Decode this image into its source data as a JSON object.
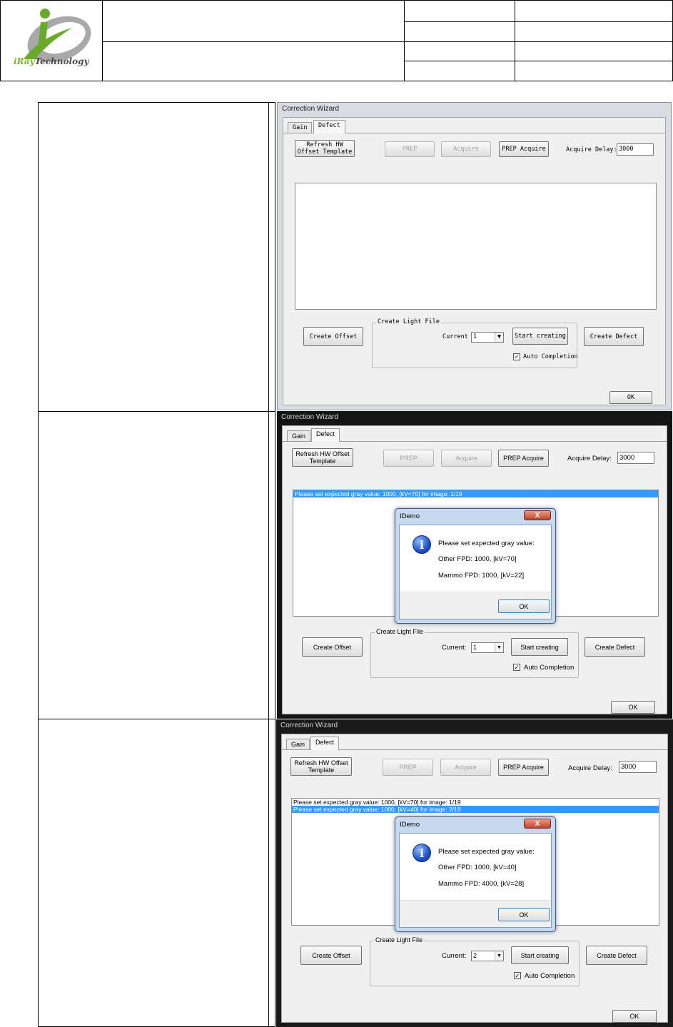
{
  "logo": {
    "brand_i": "i",
    "brand_ray": "Ray",
    "brand_tech": "Technology"
  },
  "panels": [
    {
      "title": "Correction Wizard",
      "tabs": [
        "Gain",
        "Defect"
      ],
      "refresh_btn": [
        "Refresh HW",
        "Offset Template"
      ],
      "prep_btn": "PREP",
      "acquire_btn": "Acquire",
      "prep_acquire_btn": "PREP Acquire",
      "acquire_delay_label": "Acquire Delay:",
      "acquire_delay_value": "3000",
      "list_items": [],
      "create_offset_btn": "Create Offset",
      "group_title": "Create Light File",
      "current_label": "Current",
      "current_value": "1",
      "start_btn": "Start creating",
      "create_defect_btn": "Create Defect",
      "auto_completion": "Auto Completion",
      "ok_btn": "OK"
    },
    {
      "title": "Correction Wizard",
      "tabs": [
        "Gain",
        "Defect"
      ],
      "refresh_btn": [
        "Refresh HW Offset",
        "Template"
      ],
      "prep_btn": "PREP",
      "acquire_btn": "Acquire",
      "prep_acquire_btn": "PREP Acquire",
      "acquire_delay_label": "Acquire Delay:",
      "acquire_delay_value": "3000",
      "list_items": [
        "Please set expected gray value: 1000, [kV=70] for image: 1/19"
      ],
      "create_offset_btn": "Create Offset",
      "group_title": "Create Light File",
      "current_label": "Current:",
      "current_value": "1",
      "start_btn": "Start creating",
      "create_defect_btn": "Create Defect",
      "auto_completion": "Auto Completion",
      "ok_btn": "OK",
      "dialog": {
        "title": "IDemo",
        "close": "X",
        "line1": "Please set expected gray value:",
        "line2": "Other FPD: 1000, [kV=70]",
        "line3": "Mammo FPD: 1000, [kV=22]",
        "ok": "OK"
      }
    },
    {
      "title": "Correction Wizard",
      "tabs": [
        "Gain",
        "Defect"
      ],
      "refresh_btn": [
        "Refresh HW Offset",
        "Template"
      ],
      "prep_btn": "PREP",
      "acquire_btn": "Acquire",
      "prep_acquire_btn": "PREP Acquire",
      "acquire_delay_label": "Acquire Delay:",
      "acquire_delay_value": "3000",
      "list_items": [
        "Please set expected gray value: 1000, [kV=70] for image: 1/19",
        "Please set expected gray value: 1000, [kV=40] for image: 2/19"
      ],
      "create_offset_btn": "Create Offset",
      "group_title": "Create Light File",
      "current_label": "Current:",
      "current_value": "2",
      "start_btn": "Start creating",
      "create_defect_btn": "Create Defect",
      "auto_completion": "Auto Completion",
      "ok_btn": "OK",
      "dialog": {
        "title": "IDemo",
        "close": "X",
        "line1": "Please set expected gray value:",
        "line2": "Other FPD: 1000, [kV=40]",
        "line3": "Mammo FPD: 4000, [kV=28]",
        "ok": "OK"
      }
    }
  ]
}
